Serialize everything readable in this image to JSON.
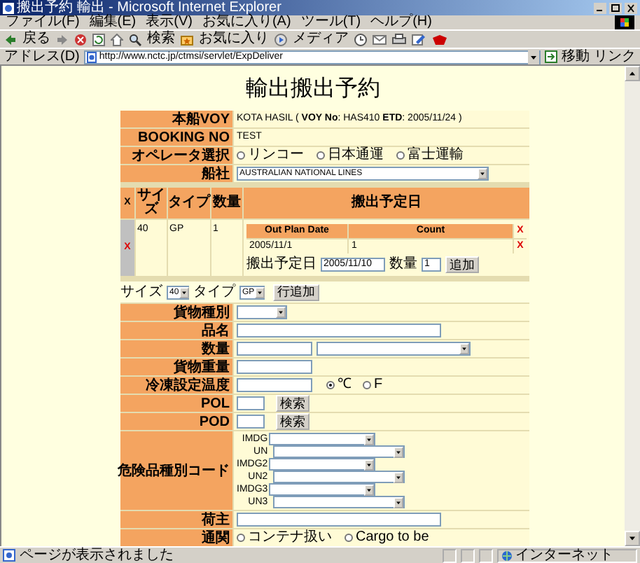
{
  "window": {
    "title": "搬出予約 輸出 - Microsoft Internet Explorer"
  },
  "menu": [
    "ファイル(F)",
    "編集(E)",
    "表示(V)",
    "お気に入り(A)",
    "ツール(T)",
    "ヘルプ(H)"
  ],
  "toolbar": {
    "back": "戻る",
    "search": "検索",
    "favorites": "お気に入り",
    "media": "メディア"
  },
  "address": {
    "label": "アドレス(D)",
    "url": "http://www.nctc.jp/ctmsi/servlet/ExpDeliver",
    "go": "移動",
    "links": "リンク"
  },
  "heading": "輸出搬出予約",
  "vessel": {
    "label": "本船VOY",
    "value": "KOTA HASIL ( **VOY No**: HAS410 **ETD**: 2005/11/24 )"
  },
  "booking": {
    "label": "BOOKING NO",
    "value": "TEST"
  },
  "operator": {
    "label": "オペレータ選択",
    "options": [
      {
        "label": "リンコー",
        "selected": false
      },
      {
        "label": "日本通運",
        "selected": false
      },
      {
        "label": "富士運輸",
        "selected": false
      }
    ]
  },
  "carrier": {
    "label": "船社",
    "value": "AUSTRALIAN NATIONAL LINES"
  },
  "containers": {
    "columns": [
      "X",
      "サイズ",
      "タイプ",
      "数量",
      "搬出予定日"
    ],
    "rows": [
      {
        "delete": "X",
        "size": "40",
        "type": "GP",
        "quantity": "1",
        "plans": {
          "columns": [
            "Out Plan Date",
            "Count",
            "X"
          ],
          "rows": [
            {
              "date": "2005/11/1",
              "count": "1",
              "delete": "X"
            }
          ]
        },
        "add": {
          "label": "搬出予定日",
          "date": "2005/11/10",
          "quantity_label": "数量",
          "quantity": "1",
          "button": "追加"
        }
      }
    ]
  },
  "add_row": {
    "size_label": "サイズ",
    "size": "40",
    "type_label": "タイプ",
    "type": "GP",
    "button": "行追加"
  },
  "fields": [
    {
      "kind": "select",
      "label": "貨物種別"
    },
    {
      "kind": "long_text",
      "label": "品名"
    },
    {
      "kind": "text_with_select",
      "label": "数量"
    },
    {
      "kind": "text",
      "label": "貨物重量"
    },
    {
      "kind": "text_with_units",
      "label": "冷凍設定温度",
      "options": [
        {
          "label": "℃",
          "selected": true
        },
        {
          "label": "F",
          "selected": false
        }
      ]
    },
    {
      "kind": "code_search",
      "label": "POL",
      "button": "検索"
    },
    {
      "kind": "code_search",
      "label": "POD",
      "button": "検索"
    },
    {
      "kind": "dg_codes",
      "label": "危険品種別コード",
      "codes": [
        "IMDG",
        "UN",
        "IMDG2",
        "UN2",
        "IMDG3",
        "UN3"
      ]
    },
    {
      "kind": "long_text",
      "label": "荷主"
    },
    {
      "kind": "radio",
      "label": "通関",
      "options": [
        {
          "label": "コンテナ扱い",
          "selected": false
        },
        {
          "label": "Cargo to be",
          "selected": false
        }
      ]
    }
  ],
  "status_bar": {
    "text": "ページが表示されました",
    "zone": "インターネット"
  }
}
